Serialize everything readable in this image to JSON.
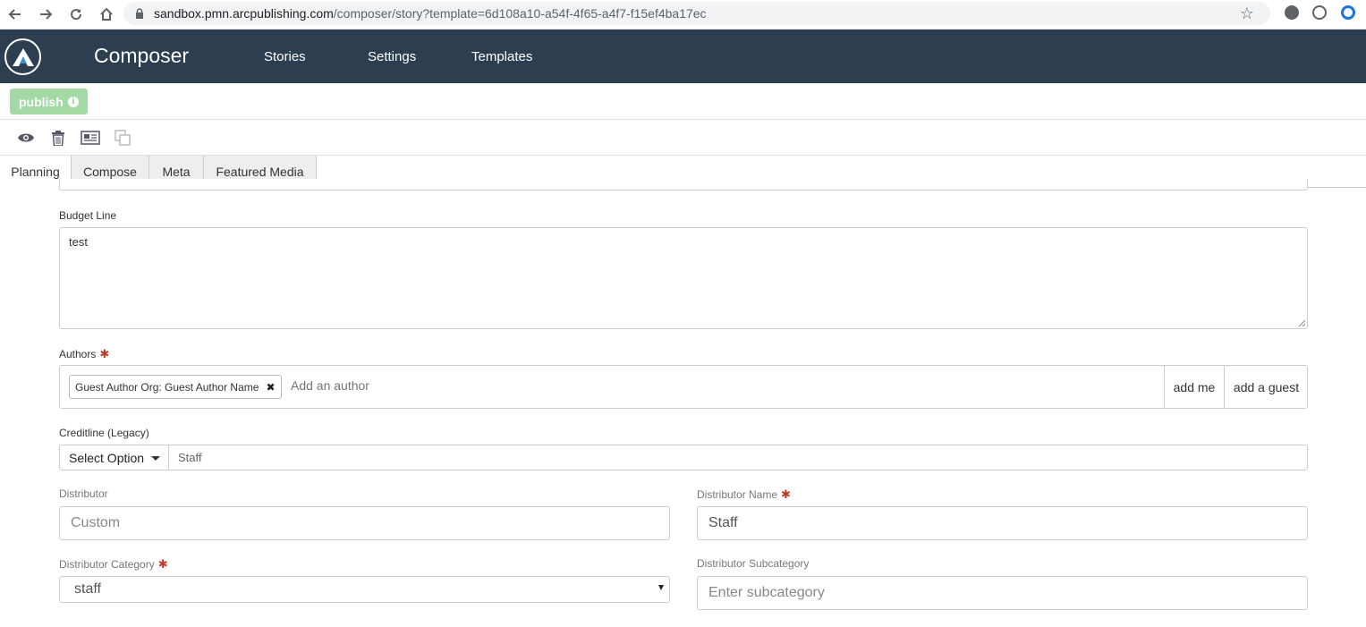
{
  "browser": {
    "url_host": "sandbox.pmn.arcpublishing.com",
    "url_path": "/composer/story?template=6d108a10-a54f-4f65-a4f7-f15ef4ba17ec"
  },
  "app": {
    "name": "Composer",
    "nav": [
      "Stories",
      "Settings",
      "Templates"
    ]
  },
  "publish": {
    "label": "publish",
    "info": "i"
  },
  "tabs": [
    "Planning",
    "Compose",
    "Meta",
    "Featured Media"
  ],
  "form": {
    "budget_line": {
      "label": "Budget Line",
      "value": "test"
    },
    "authors": {
      "label": "Authors",
      "chip": "Guest Author Org: Guest Author Name",
      "placeholder": "Add an author",
      "add_me": "add me",
      "add_guest": "add a guest"
    },
    "creditline": {
      "label": "Creditline (Legacy)",
      "select": "Select Option",
      "value": "Staff"
    },
    "distributor": {
      "label": "Distributor",
      "placeholder": "Custom"
    },
    "distributor_name": {
      "label": "Distributor Name",
      "value": "Staff"
    },
    "distributor_category": {
      "label": "Distributor Category",
      "value": "staff"
    },
    "distributor_subcategory": {
      "label": "Distributor Subcategory",
      "placeholder": "Enter subcategory"
    },
    "required_mark": "✱"
  }
}
